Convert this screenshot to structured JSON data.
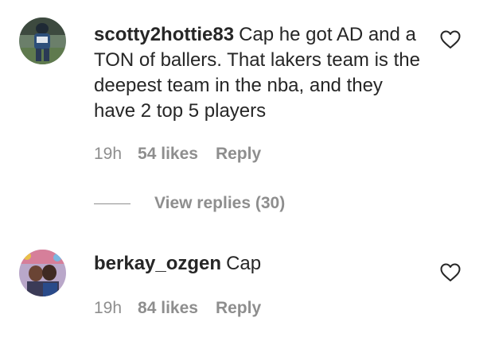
{
  "comments": [
    {
      "username": "scotty2hottie83",
      "text": "Cap he got AD and a TON of ballers. That lakers team is the deepest team in the nba, and they have 2 top 5 players",
      "time": "19h",
      "likes": "54 likes",
      "reply_label": "Reply",
      "avatar_icon": "user-avatar-football-player",
      "view_replies": "View replies (30)"
    },
    {
      "username": "berkay_ozgen",
      "text": "Cap",
      "time": "19h",
      "likes": "84 likes",
      "reply_label": "Reply",
      "avatar_icon": "user-avatar-two-people"
    }
  ],
  "like_icon": "heart-outline-icon",
  "colors": {
    "primary_text": "#262626",
    "secondary_text": "#8e8e8e",
    "background": "#ffffff"
  }
}
